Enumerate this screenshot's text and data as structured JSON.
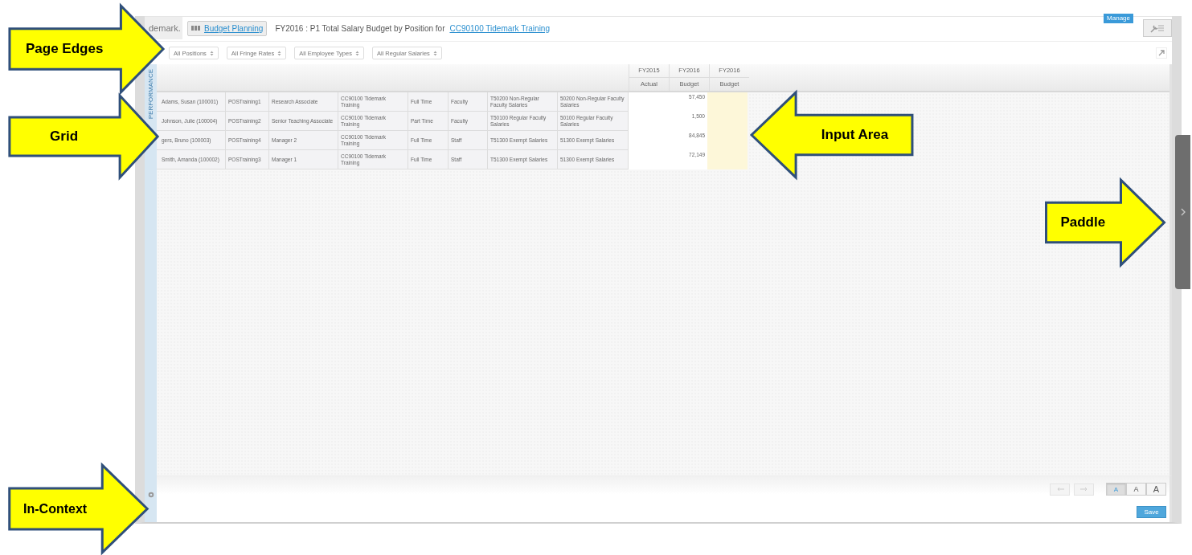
{
  "header": {
    "logo": "demark.",
    "breadcrumb": "Budget Planning",
    "title": "FY2016 : P1 Total Salary Budget by Position for",
    "cost_center_link": "CC90100 Tidemark Training",
    "badge": "Manage"
  },
  "filters": [
    {
      "label": "All Positions"
    },
    {
      "label": "All Fringe Rates"
    },
    {
      "label": "All Employee Types"
    },
    {
      "label": "All Regular Salaries"
    }
  ],
  "side_strip": {
    "label": "PERFORMANCE"
  },
  "table": {
    "columns": [
      {
        "line1": "FY2015",
        "line2": "Actual",
        "kind": "value"
      },
      {
        "line1": "FY2016",
        "line2": "Budget",
        "kind": "value"
      },
      {
        "line1": "FY2016",
        "line2": "Budget",
        "kind": "input"
      }
    ],
    "rows": [
      {
        "cells": [
          "Adams, Susan (100001)",
          "POSTraining1",
          "Research Associate",
          "CC90100 Tidemark Training",
          "Full Time",
          "Faculty",
          "T50200 Non-Regular Faculty Salaries",
          "50200 Non-Regular Faculty Salaries"
        ],
        "budget": "57,450"
      },
      {
        "cells": [
          "Johnson, Julie (100004)",
          "POSTraining2",
          "Senior Teaching Associate",
          "CC90100 Tidemark Training",
          "Part Time",
          "Faculty",
          "T50100 Regular Faculty Salaries",
          "50100 Regular Faculty Salaries"
        ],
        "budget": "1,500"
      },
      {
        "cells": [
          "gers, Bruno (100003)",
          "POSTraining4",
          "Manager 2",
          "CC90100 Tidemark Training",
          "Full Time",
          "Staff",
          "T51300 Exempt Salaries",
          "51300 Exempt Salaries"
        ],
        "budget": "84,845"
      },
      {
        "cells": [
          "Smith, Amanda (100002)",
          "POSTraining3",
          "Manager 1",
          "CC90100 Tidemark Training",
          "Full Time",
          "Staff",
          "T51300 Exempt Salaries",
          "51300 Exempt Salaries"
        ],
        "budget": "72,149"
      }
    ]
  },
  "history_buttons": [
    {
      "kind": "undo",
      "disabled": true
    },
    {
      "kind": "redo",
      "disabled": true
    }
  ],
  "text_size_buttons": [
    {
      "label": "A",
      "selected": true
    },
    {
      "label": "A",
      "selected": false
    },
    {
      "label": "A",
      "selected": false
    }
  ],
  "save_button": "Save",
  "callouts": [
    {
      "label": "Page Edges",
      "kind": "right"
    },
    {
      "label": "Grid",
      "kind": "right"
    },
    {
      "label": "Input Area",
      "kind": "left"
    },
    {
      "label": "Paddle",
      "kind": "right"
    },
    {
      "label": "In-Context",
      "kind": "right"
    }
  ]
}
